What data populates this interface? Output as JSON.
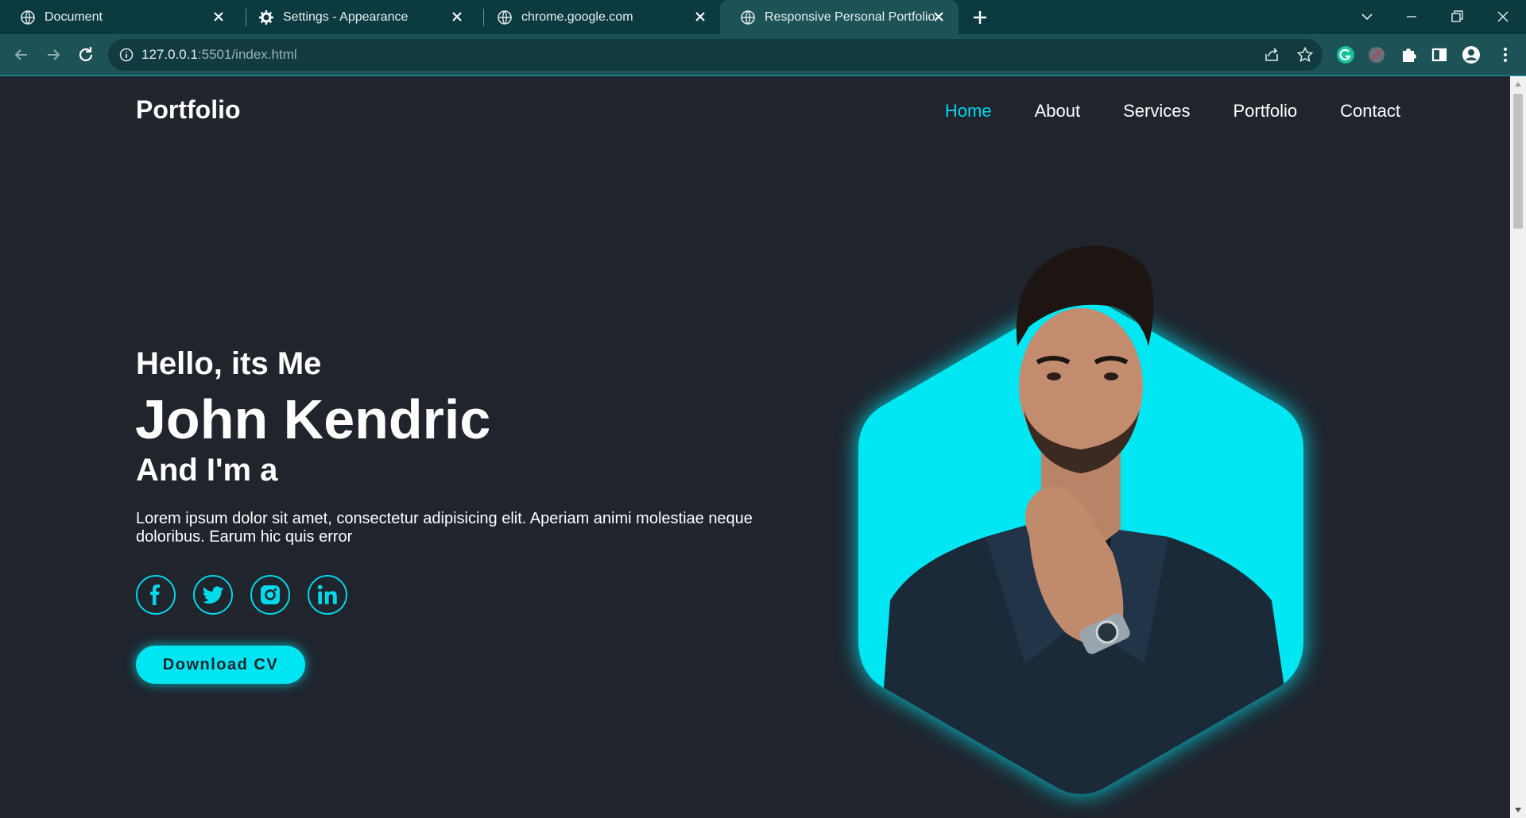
{
  "browser": {
    "tabs": [
      {
        "title": "Document",
        "icon": "globe-icon",
        "active": false
      },
      {
        "title": "Settings - Appearance",
        "icon": "gear-icon",
        "active": false
      },
      {
        "title": "chrome.google.com",
        "icon": "globe-icon",
        "active": false
      },
      {
        "title": "Responsive Personal Portfolio W",
        "icon": "globe-icon",
        "active": true
      }
    ],
    "url_host": "127.0.0.1",
    "url_path": ":5501/index.html"
  },
  "page": {
    "logo": "Portfolio",
    "nav": [
      {
        "label": "Home",
        "active": true
      },
      {
        "label": "About",
        "active": false
      },
      {
        "label": "Services",
        "active": false
      },
      {
        "label": "Portfolio",
        "active": false
      },
      {
        "label": "Contact",
        "active": false
      }
    ],
    "hero": {
      "greeting": "Hello, its Me",
      "name": "John Kendric",
      "role": "And I'm a",
      "description": "Lorem ipsum dolor sit amet, consectetur adipisicing elit. Aperiam animi molestiae neque doloribus. Earum hic quis error",
      "socials": [
        "facebook-icon",
        "twitter-icon",
        "instagram-icon",
        "linkedin-icon"
      ],
      "cta": "Download CV"
    },
    "colors": {
      "background": "#1f242d",
      "accent": "#00d9ea",
      "text": "#ffffff"
    }
  }
}
